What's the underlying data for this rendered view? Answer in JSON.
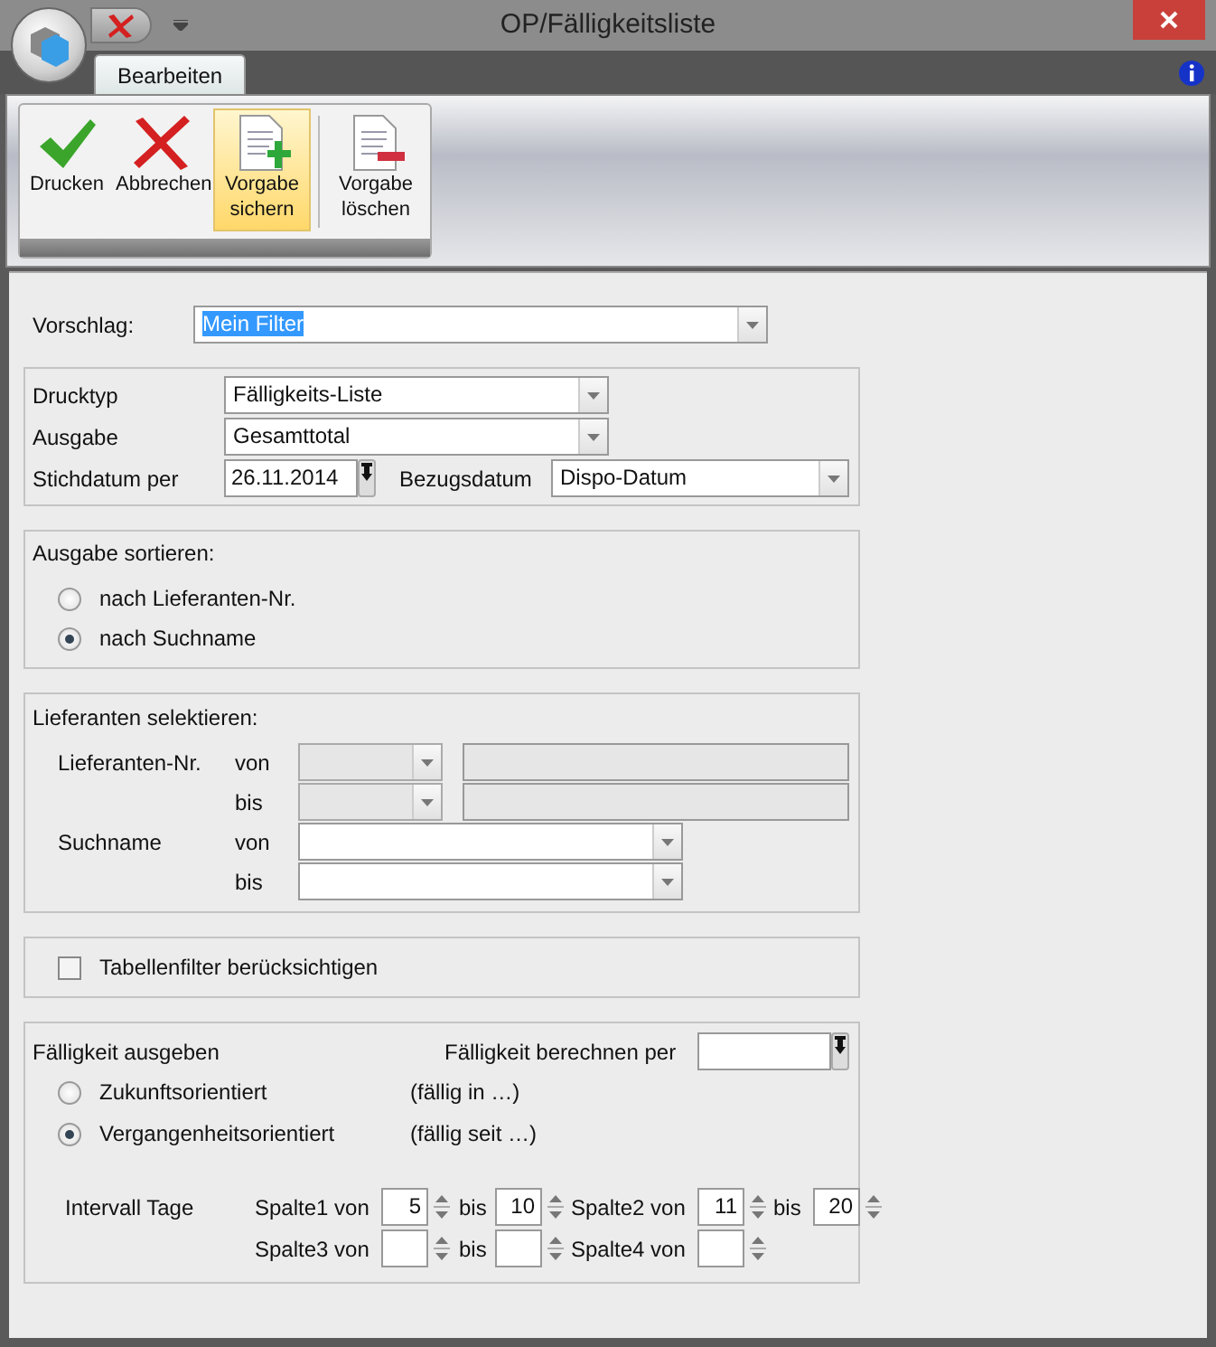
{
  "window": {
    "title": "OP/Fälligkeitsliste"
  },
  "ribbon": {
    "tabs": [
      {
        "label": "Bearbeiten",
        "selected": true
      }
    ],
    "buttons": [
      {
        "kind": "check",
        "label": "Drucken",
        "hovered": false
      },
      {
        "kind": "cross",
        "label": "Abbrechen",
        "hovered": false
      },
      {
        "kind": "doc-add",
        "label": "Vorgabe sichern",
        "hovered": true
      },
      {
        "kind": "doc-remove",
        "label": "Vorgabe löschen",
        "hovered": false
      }
    ]
  },
  "vorschlag": {
    "label": "Vorschlag:",
    "value": "Mein Filter"
  },
  "print": {
    "drucktyp": {
      "label": "Drucktyp",
      "value": "Fälligkeits-Liste"
    },
    "ausgabe": {
      "label": "Ausgabe",
      "value": "Gesamttotal"
    },
    "stichdatum": {
      "label": "Stichdatum per",
      "value": "26.11.2014"
    },
    "bezugsdatum": {
      "label": "Bezugsdatum",
      "value": "Dispo-Datum"
    }
  },
  "sort": {
    "title": "Ausgabe sortieren:",
    "options": [
      {
        "label": "nach Lieferanten-Nr.",
        "selected": false
      },
      {
        "label": "nach Suchname",
        "selected": true
      }
    ]
  },
  "supplier": {
    "title": "Lieferanten selektieren:",
    "rows": [
      {
        "label": "Lieferanten-Nr.",
        "from": "von",
        "to": "bis",
        "disabled": true
      },
      {
        "label": "Suchname",
        "from": "von",
        "to": "bis",
        "disabled": false
      }
    ]
  },
  "table_filter": {
    "label": "Tabellenfilter berücksichtigen",
    "checked": false
  },
  "due": {
    "title": "Fälligkeit ausgeben",
    "calc_label": "Fälligkeit berechnen per",
    "options": [
      {
        "label": "Zukunftsorientiert",
        "note": "(fällig in …)",
        "selected": false
      },
      {
        "label": "Vergangenheitsorientiert",
        "note": "(fällig seit …)",
        "selected": true
      }
    ],
    "interval_label": "Intervall Tage",
    "columns": [
      {
        "label": "Spalte1 von",
        "from": "5",
        "to_label": "bis",
        "to": "10"
      },
      {
        "label": "Spalte2 von",
        "from": "11",
        "to_label": "bis",
        "to": "20"
      },
      {
        "label": "Spalte3 von",
        "to_label": "bis"
      },
      {
        "label": "Spalte4 von"
      }
    ]
  }
}
